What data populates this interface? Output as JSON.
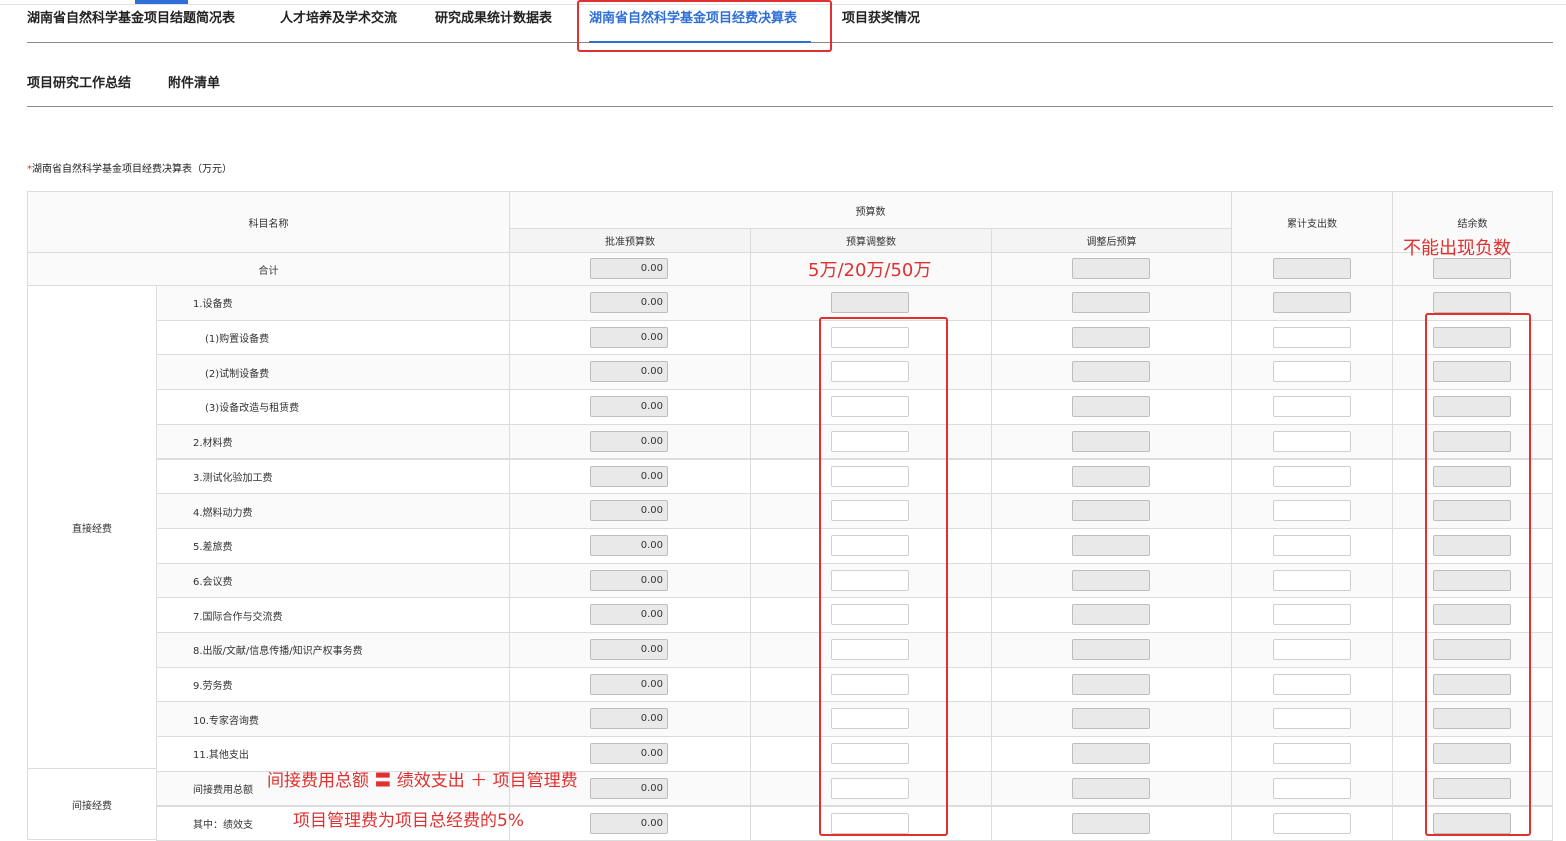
{
  "tabs_row1": [
    {
      "label": "湖南省自然科学基金项目结题简况表"
    },
    {
      "label": "人才培养及学术交流"
    },
    {
      "label": "研究成果统计数据表"
    },
    {
      "label": "湖南省自然科学基金项目经费决算表"
    },
    {
      "label": "项目获奖情况"
    }
  ],
  "active_tab": "湖南省自然科学基金项目经费决算表",
  "tabs_row2": [
    {
      "label": "项目研究工作总结"
    },
    {
      "label": "附件清单"
    }
  ],
  "form_title": {
    "required_mark": "*",
    "text": "湖南省自然科学基金项目经费决算表（万元）"
  },
  "headers": {
    "subject_name": "科目名称",
    "budget_group": "预算数",
    "approved": "批准预算数",
    "adjustment": "预算调整数",
    "adjusted": "调整后预算",
    "cumulative": "累计支出数",
    "balance": "结余数"
  },
  "total_row": {
    "label": "合计",
    "approved_value": "0.00"
  },
  "groups": {
    "direct": "直接经费",
    "indirect": "间接经费"
  },
  "rows": [
    {
      "label": "1.设备费",
      "approved": "0.00"
    },
    {
      "label": "(1)购置设备费",
      "approved": "0.00"
    },
    {
      "label": "(2)试制设备费",
      "approved": "0.00"
    },
    {
      "label": "(3)设备改造与租赁费",
      "approved": "0.00"
    },
    {
      "label": "2.材料费",
      "approved": "0.00"
    },
    {
      "label": "3.测试化验加工费",
      "approved": "0.00"
    },
    {
      "label": "4.燃料动力费",
      "approved": "0.00"
    },
    {
      "label": "5.差旅费",
      "approved": "0.00"
    },
    {
      "label": "6.会议费",
      "approved": "0.00"
    },
    {
      "label": "7.国际合作与交流费",
      "approved": "0.00"
    },
    {
      "label": "8.出版/文献/信息传播/知识产权事务费",
      "approved": "0.00"
    },
    {
      "label": "9.劳务费",
      "approved": "0.00"
    },
    {
      "label": "10.专家咨询费",
      "approved": "0.00"
    },
    {
      "label": "11.其他支出",
      "approved": "0.00"
    },
    {
      "label": "间接费用总额",
      "approved": "0.00"
    },
    {
      "label": "其中：绩效支",
      "approved": "0.00"
    }
  ],
  "annotations": {
    "budget_limit": "5万/20万/50万",
    "no_negative": "不能出现负数",
    "indirect_formula": "间接费用总额 〓 绩效支出 ＋ 项目管理费",
    "management_fee": "项目管理费为项目总经费的5%"
  },
  "colors": {
    "accent": "#2f6fd6",
    "annotation": "#e03030"
  }
}
